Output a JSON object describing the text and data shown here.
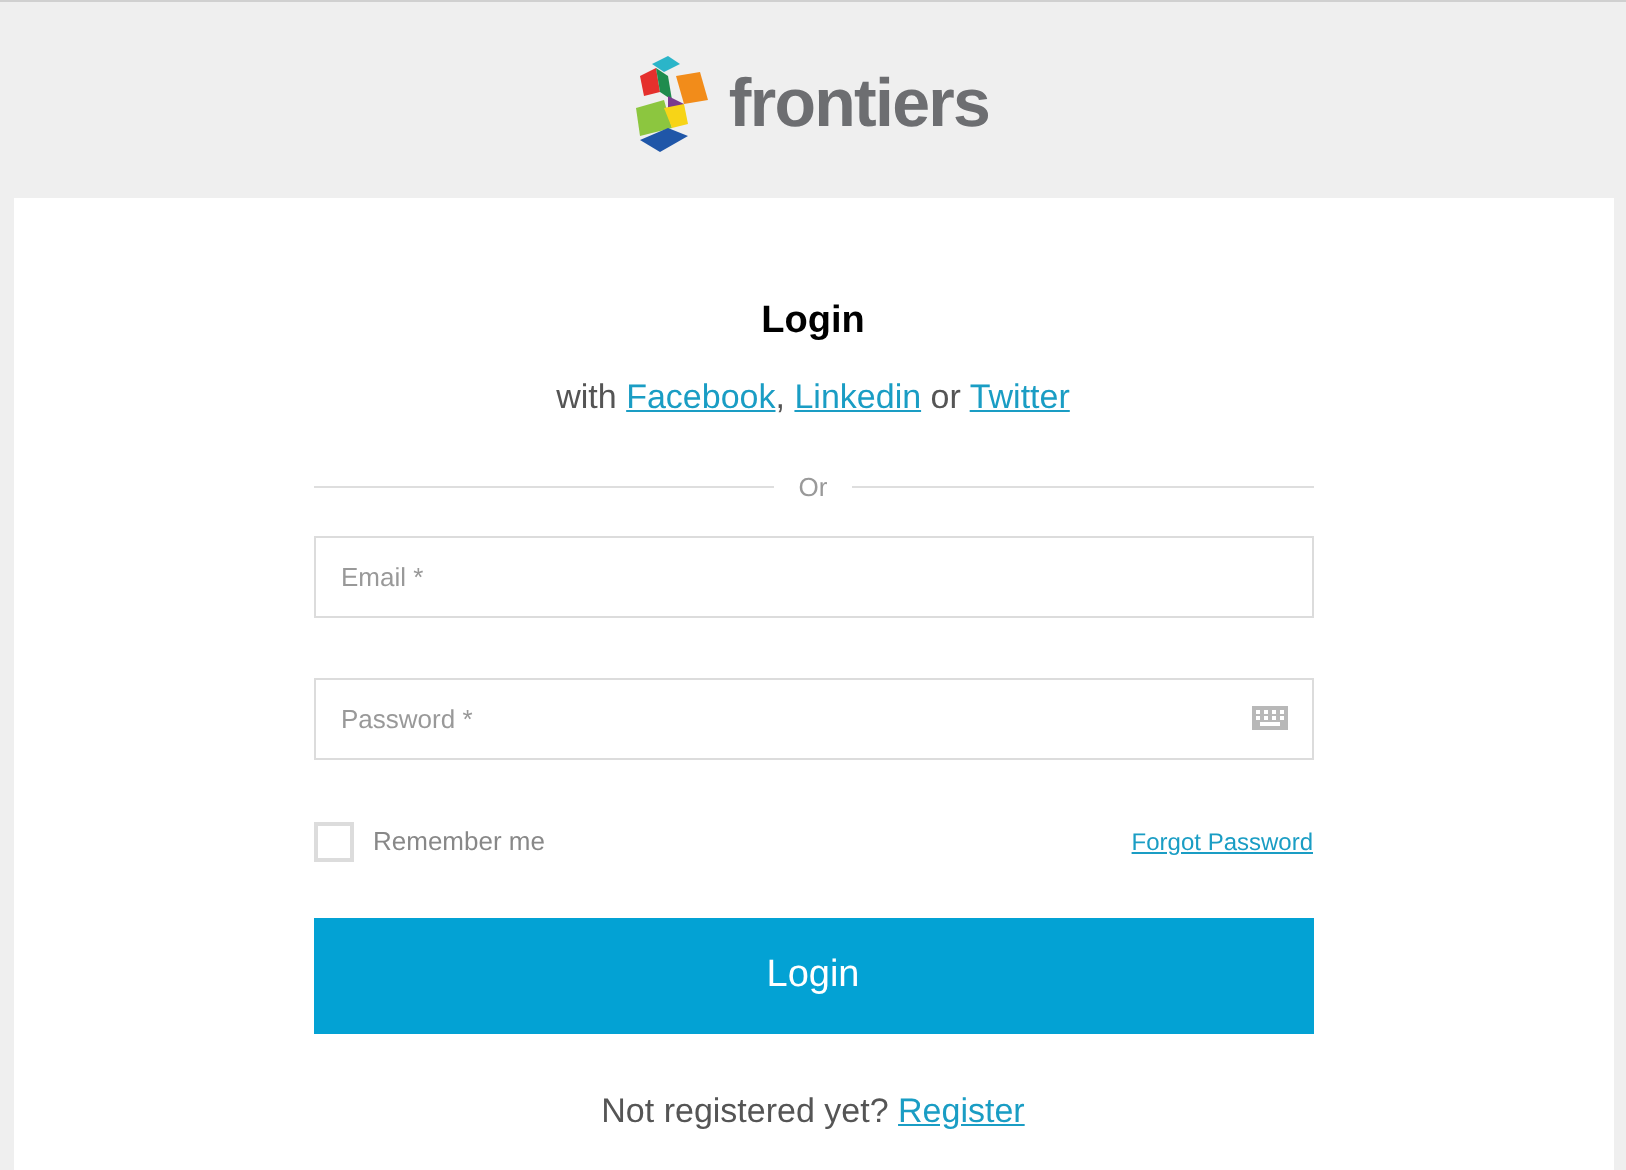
{
  "logo": {
    "text": "frontiers"
  },
  "title": "Login",
  "social": {
    "prefix": "with",
    "links": [
      "Facebook",
      "Linkedin",
      "Twitter"
    ],
    "joiners": [
      ",",
      "or"
    ]
  },
  "divider": "Or",
  "fields": [
    {
      "placeholder": "Email *",
      "kind": "text"
    },
    {
      "placeholder": "Password *",
      "kind": "password"
    }
  ],
  "remember": {
    "label": "Remember me",
    "checked": false
  },
  "forgot": "Forgot Password",
  "submit": "Login",
  "register": {
    "prompt": "Not registered yet?",
    "link": "Register"
  }
}
